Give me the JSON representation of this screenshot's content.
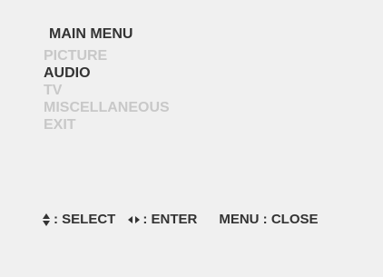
{
  "menu": {
    "title": "MAIN MENU",
    "items": [
      {
        "label": "PICTURE",
        "selected": false
      },
      {
        "label": "AUDIO",
        "selected": true
      },
      {
        "label": "TV",
        "selected": false
      },
      {
        "label": "MISCELLANEOUS",
        "selected": false
      },
      {
        "label": "EXIT",
        "selected": false
      }
    ]
  },
  "hints": {
    "select_label": ": SELECT",
    "select_icon": "up-down-arrows-icon",
    "enter_label": ": ENTER",
    "enter_icon": "left-right-arrows-icon",
    "close_label": "MENU : CLOSE"
  },
  "colors": {
    "background": "#f0f0f0",
    "active_text": "#333333",
    "inactive_text": "#c8c8c8"
  }
}
